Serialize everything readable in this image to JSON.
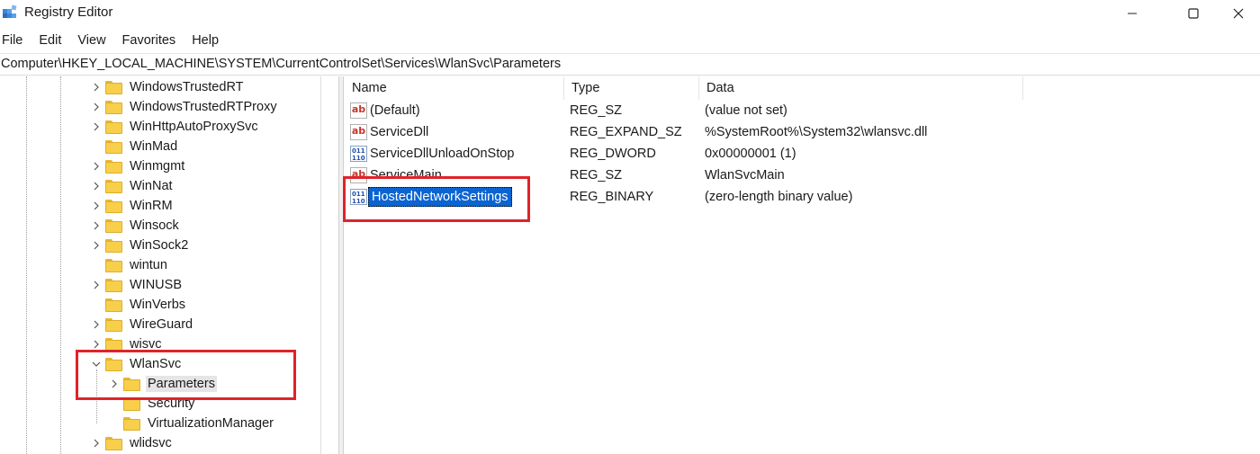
{
  "window": {
    "title": "Registry Editor",
    "app_icon": "registry-icon"
  },
  "menu": [
    "File",
    "Edit",
    "View",
    "Favorites",
    "Help"
  ],
  "address": "Computer\\HKEY_LOCAL_MACHINE\\SYSTEM\\CurrentControlSet\\Services\\WlanSvc\\Parameters",
  "tree": [
    {
      "label": "WindowsTrustedRT",
      "expander": "collapsed"
    },
    {
      "label": "WindowsTrustedRTProxy",
      "expander": "collapsed"
    },
    {
      "label": "WinHttpAutoProxySvc",
      "expander": "collapsed"
    },
    {
      "label": "WinMad",
      "expander": "none"
    },
    {
      "label": "Winmgmt",
      "expander": "collapsed"
    },
    {
      "label": "WinNat",
      "expander": "collapsed"
    },
    {
      "label": "WinRM",
      "expander": "collapsed"
    },
    {
      "label": "Winsock",
      "expander": "collapsed"
    },
    {
      "label": "WinSock2",
      "expander": "collapsed"
    },
    {
      "label": "wintun",
      "expander": "none"
    },
    {
      "label": "WINUSB",
      "expander": "collapsed"
    },
    {
      "label": "WinVerbs",
      "expander": "none"
    },
    {
      "label": "WireGuard",
      "expander": "collapsed"
    },
    {
      "label": "wisvc",
      "expander": "collapsed"
    },
    {
      "label": "WlanSvc",
      "expander": "expanded"
    },
    {
      "label": "Parameters",
      "expander": "collapsed",
      "selected": true
    },
    {
      "label": "Security",
      "expander": "none"
    },
    {
      "label": "VirtualizationManager",
      "expander": "none"
    },
    {
      "label": "wlidsvc",
      "expander": "collapsed"
    }
  ],
  "columns": {
    "name": "Name",
    "type": "Type",
    "data": "Data"
  },
  "values": [
    {
      "name": "(Default)",
      "type": "REG_SZ",
      "data": "(value not set)",
      "icon": "string-value-icon"
    },
    {
      "name": "ServiceDll",
      "type": "REG_EXPAND_SZ",
      "data": "%SystemRoot%\\System32\\wlansvc.dll",
      "icon": "string-value-icon"
    },
    {
      "name": "ServiceDllUnloadOnStop",
      "type": "REG_DWORD",
      "data": "0x00000001 (1)",
      "icon": "binary-value-icon"
    },
    {
      "name": "ServiceMain",
      "type": "REG_SZ",
      "data": "WlanSvcMain",
      "icon": "string-value-icon"
    },
    {
      "name": "HostedNetworkSettings",
      "type": "REG_BINARY",
      "data": "(zero-length binary value)",
      "icon": "binary-value-icon",
      "selected": true
    }
  ],
  "highlight_color": "#e0232a",
  "selection_color": "#0a64d2"
}
